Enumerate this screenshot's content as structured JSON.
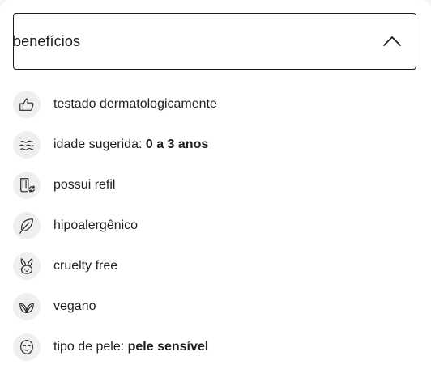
{
  "accordion": {
    "title": "benefícios",
    "expanded": true
  },
  "items": [
    {
      "icon": "thumbs-up-icon",
      "label": "testado dermatologicamente",
      "value": ""
    },
    {
      "icon": "waves-icon",
      "label": "idade sugerida: ",
      "value": "0 a 3 anos"
    },
    {
      "icon": "refill-icon",
      "label": "possui refil",
      "value": ""
    },
    {
      "icon": "leaf-icon",
      "label": "hipoalergênico",
      "value": ""
    },
    {
      "icon": "rabbit-icon",
      "label": "cruelty free",
      "value": ""
    },
    {
      "icon": "vegan-leaves-icon",
      "label": "vegano",
      "value": ""
    },
    {
      "icon": "face-icon",
      "label": "tipo de pele: ",
      "value": "pele sensível"
    }
  ]
}
